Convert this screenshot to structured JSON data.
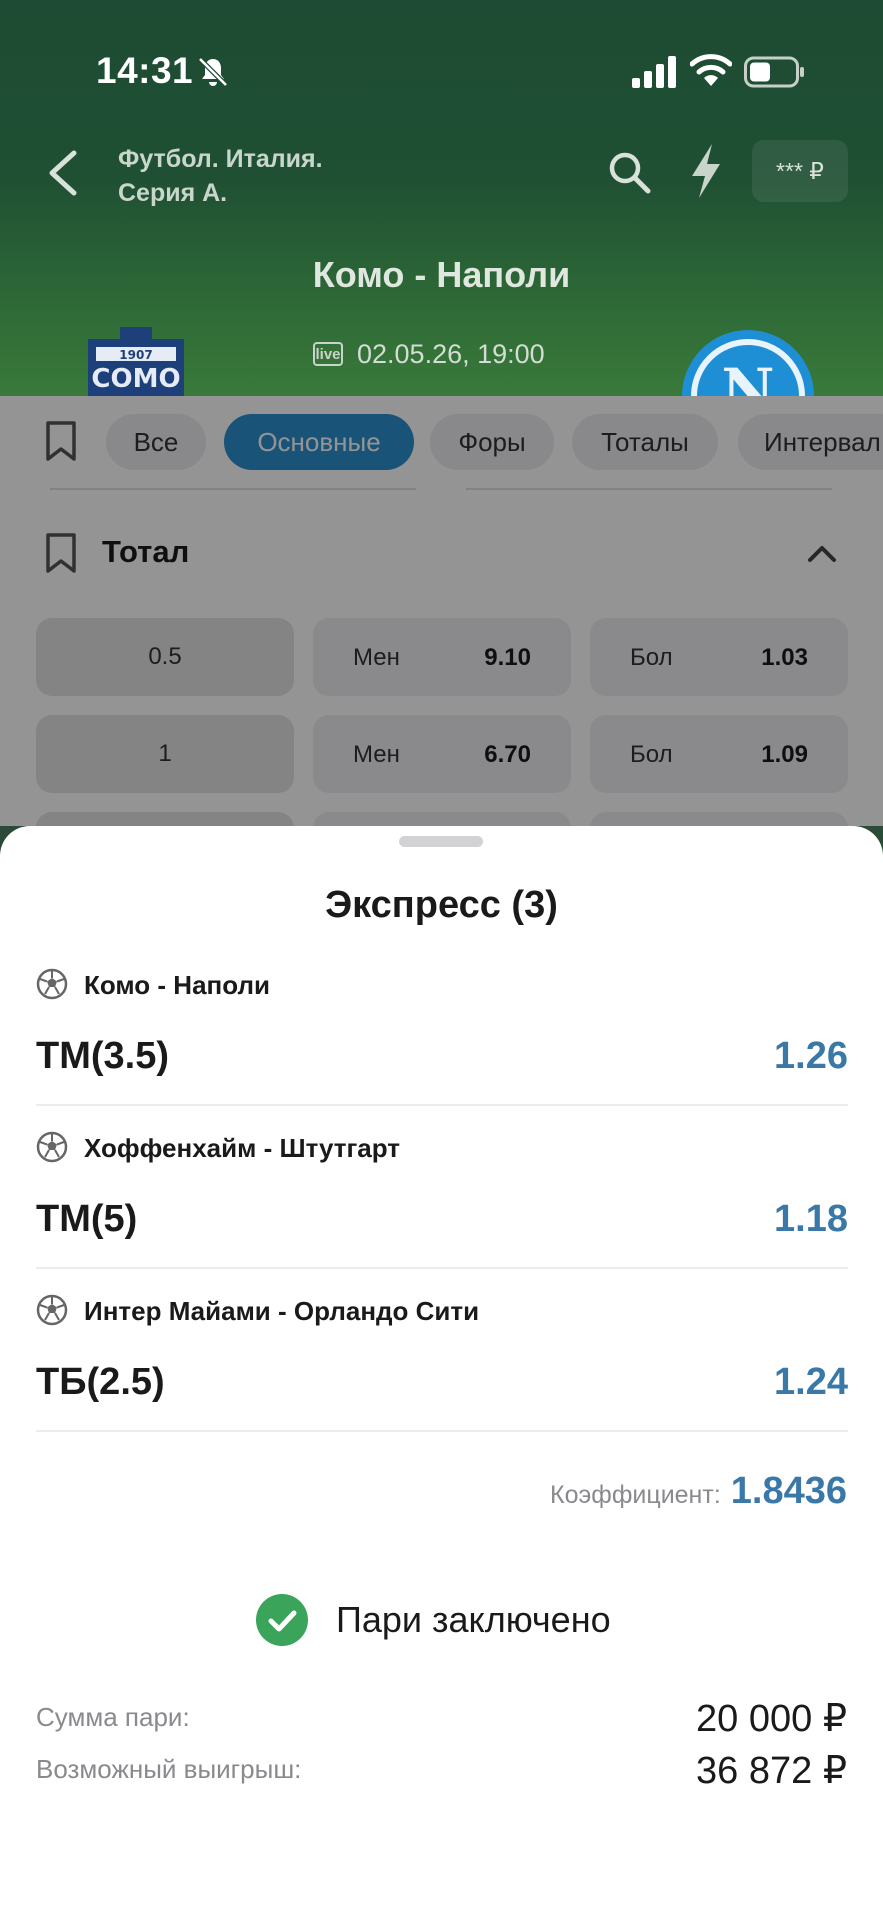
{
  "status_bar": {
    "time": "14:31"
  },
  "header": {
    "breadcrumb_line1": "Футбол. Италия.",
    "breadcrumb_line2": "Серия А.",
    "balance": "*** ₽",
    "match_title": "Комо - Наполи",
    "live_label": "live",
    "match_date": "02.05.26, 19:00",
    "home_logo_text": "1907 COMO",
    "away_logo_letter": "N"
  },
  "filters": {
    "items": [
      "Все",
      "Основные",
      "Форы",
      "Тоталы",
      "Интервал"
    ],
    "active_index": 1
  },
  "market": {
    "title": "Тотал",
    "rows": [
      {
        "line": "0.5",
        "under_label": "Мен",
        "under_odds": "9.10",
        "over_label": "Бол",
        "over_odds": "1.03"
      },
      {
        "line": "1",
        "under_label": "Мен",
        "under_odds": "6.70",
        "over_label": "Бол",
        "over_odds": "1.09"
      }
    ]
  },
  "betslip": {
    "title": "Экспресс (3)",
    "bets": [
      {
        "event": "Комо - Наполи",
        "outcome": "ТМ(3.5)",
        "odds": "1.26"
      },
      {
        "event": "Хоффенхайм - Штутгарт",
        "outcome": "ТМ(5)",
        "odds": "1.18"
      },
      {
        "event": "Интер Майами - Орландо Сити",
        "outcome": "ТБ(2.5)",
        "odds": "1.24"
      }
    ],
    "coef_label": "Коэффициент:",
    "coef_value": "1.8436",
    "success_text": "Пари заключено",
    "stake_label": "Сумма пари:",
    "stake_value": "20 000 ₽",
    "win_label": "Возможный выигрыш:",
    "win_value": "36 872 ₽"
  },
  "colors": {
    "header_green": "#1f5033",
    "accent_blue": "#3a78a8",
    "chip_active": "#2d8fcf",
    "success_green": "#3aa55a"
  },
  "icons": [
    "bell-off-icon",
    "signal-icon",
    "wifi-icon",
    "battery-icon",
    "back-arrow-icon",
    "search-icon",
    "lightning-icon",
    "bookmark-icon",
    "chevron-up-icon",
    "soccer-ball-icon",
    "check-circle-icon"
  ]
}
